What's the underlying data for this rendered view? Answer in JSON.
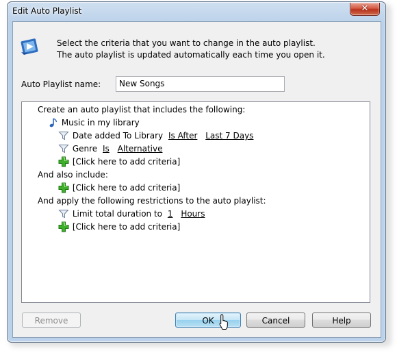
{
  "window": {
    "title": "Edit Auto Playlist",
    "close_glyph": "✕"
  },
  "instructions": {
    "line1": "Select the criteria that you want to change in the auto playlist.",
    "line2": "The auto playlist is updated automatically each time you open it."
  },
  "playlist_name": {
    "label": "Auto Playlist name:",
    "value": "New Songs"
  },
  "criteria": {
    "header_includes": "Create an auto playlist that includes the following:",
    "source": "Music in my library",
    "rule1": {
      "field": "Date added To Library",
      "operator": "Is After",
      "value": "Last 7 Days"
    },
    "rule2": {
      "field": "Genre",
      "operator": "Is",
      "value": "Alternative"
    },
    "add_criteria": "[Click here to add criteria]",
    "header_also": "And also include:",
    "header_restrictions": "And apply the following restrictions to the auto playlist:",
    "restriction": {
      "field": "Limit total duration to",
      "value": "1",
      "unit": "Hours"
    }
  },
  "buttons": {
    "remove": "Remove",
    "ok": "OK",
    "cancel": "Cancel",
    "help": "Help"
  },
  "icons": {
    "app": "playlist-app-icon",
    "music_note": "music-note-icon",
    "filter": "filter-icon",
    "add": "add-plus-icon",
    "cursor": "mouse-cursor-icon"
  }
}
